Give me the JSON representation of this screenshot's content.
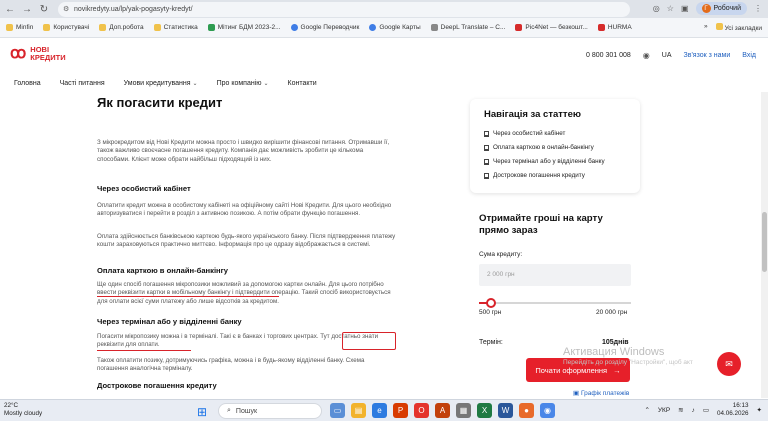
{
  "browser": {
    "url": "novikredyty.ua/lp/yak-pogasyty-kredyt/",
    "profile_label": "Робочий",
    "profile_initial": "Г"
  },
  "bookmarks": {
    "items": [
      {
        "label": "Minfin",
        "icon": "bookmark-icon"
      },
      {
        "label": "Користувачі",
        "icon": "folder-icon"
      },
      {
        "label": "Доп.робота",
        "icon": "folder-icon"
      },
      {
        "label": "Статистика",
        "icon": "folder-icon"
      },
      {
        "label": "Мітинг БДМ 2023-2...",
        "icon": "doc-icon"
      },
      {
        "label": "Google Переводчик",
        "icon": "translate-icon"
      },
      {
        "label": "Google Карты",
        "icon": "maps-icon"
      },
      {
        "label": "DeepL Translate – С...",
        "icon": "deepl-icon"
      },
      {
        "label": "Pic4Net — безкошт...",
        "icon": "pic-icon"
      },
      {
        "label": "HURMA",
        "icon": "hurma-icon"
      }
    ],
    "more": "»",
    "all_bookmarks": "Усі закладки"
  },
  "header": {
    "logo_line1": "НОВІ",
    "logo_line2": "КРЕДИТИ",
    "phone": "0 800 301 008",
    "lang": "UA",
    "callback": "Зв'язок з нами",
    "login": "Вхід"
  },
  "nav": {
    "items": [
      {
        "label": "Головна",
        "dropdown": false
      },
      {
        "label": "Часті питання",
        "dropdown": false
      },
      {
        "label": "Умови кредитування",
        "dropdown": true
      },
      {
        "label": "Про компанію",
        "dropdown": true
      },
      {
        "label": "Контакти",
        "dropdown": false
      }
    ]
  },
  "article": {
    "title": "Як погасити кредит",
    "intro": "З мікрокредитом від Нові Кредити можна просто і швидко вирішити фінансові питання. Отримавши її, також важливо своєчасне погашення кредиту. Компанія дає можливість зробити це кількома способами. Клієнт може обрати найбільш підходящий із них.",
    "s1_heading": "Через особистий кабінет",
    "s1_p1": "Оплатити кредит можна в особистому кабінеті на офіційному сайті Нові Кредити. Для цього необхідно авторизуватися і перейти в розділ з активною позикою. А потім обрати функцію погашення.",
    "s1_p2": "Оплата здійснюється банківською карткою будь-якого українського банку. Після підтвердження платежу кошти зараховуються практично миттєво. Інформація про це одразу відображається в системі.",
    "s2_heading": "Оплата карткою в онлайн-банкінгу",
    "s2_p1": "Ще один спосіб погашення мікропозики можливий за допомогою картки онлайн. Для цього потрібно ввести реквізити картки в мобільному банкінгу і підтвердити операцію. Такий спосіб використовується для оплати всієї суми платежу або лише відсотків за кредитом.",
    "s3_heading": "Через термінал або у відділенні банку",
    "s3_p1": "Погасити мікропозику можна і в терміналі. Такі є в банках і торгових центрах. Тут достатньо знати реквізити для оплати.",
    "s3_p2": "Також оплатити позику, дотримуючись графіка, можна і в будь-якому відділенні банку. Схема погашення аналогічна терміналу.",
    "s4_heading": "Дострокове погашення кредиту"
  },
  "toc": {
    "title": "Навігація за статтею",
    "items": [
      "Через особистий кабінет",
      "Оплата карткою в онлайн-банкінгу",
      "Через термінал або у відділенні банку",
      "Дострокове погашення кредиту"
    ]
  },
  "loan": {
    "title": "Отримайте гроші на карту прямо зараз",
    "amount_label": "Сума кредиту:",
    "amount_placeholder": "2 000 грн",
    "slider_min": "500 грн",
    "slider_max": "20 000 грн",
    "slider_value_fraction": 0.08,
    "term_label": "Термін:",
    "term_value": "105днів",
    "cta_label": "Почати оформлення",
    "schedule_link": "Графік платежів"
  },
  "overlay": {
    "activate_title": "Активация Windows",
    "activate_sub": "Перейдіть до розділу \"Настройки\", щоб акт"
  },
  "taskbar": {
    "temp": "22°C",
    "weather": "Mostly cloudy",
    "search_label": "Пошук",
    "lang": "УКР",
    "time": "16:13",
    "date": "04.06.2026"
  },
  "colors": {
    "brand_red": "#e6202a",
    "link_blue": "#1e5fbf"
  }
}
